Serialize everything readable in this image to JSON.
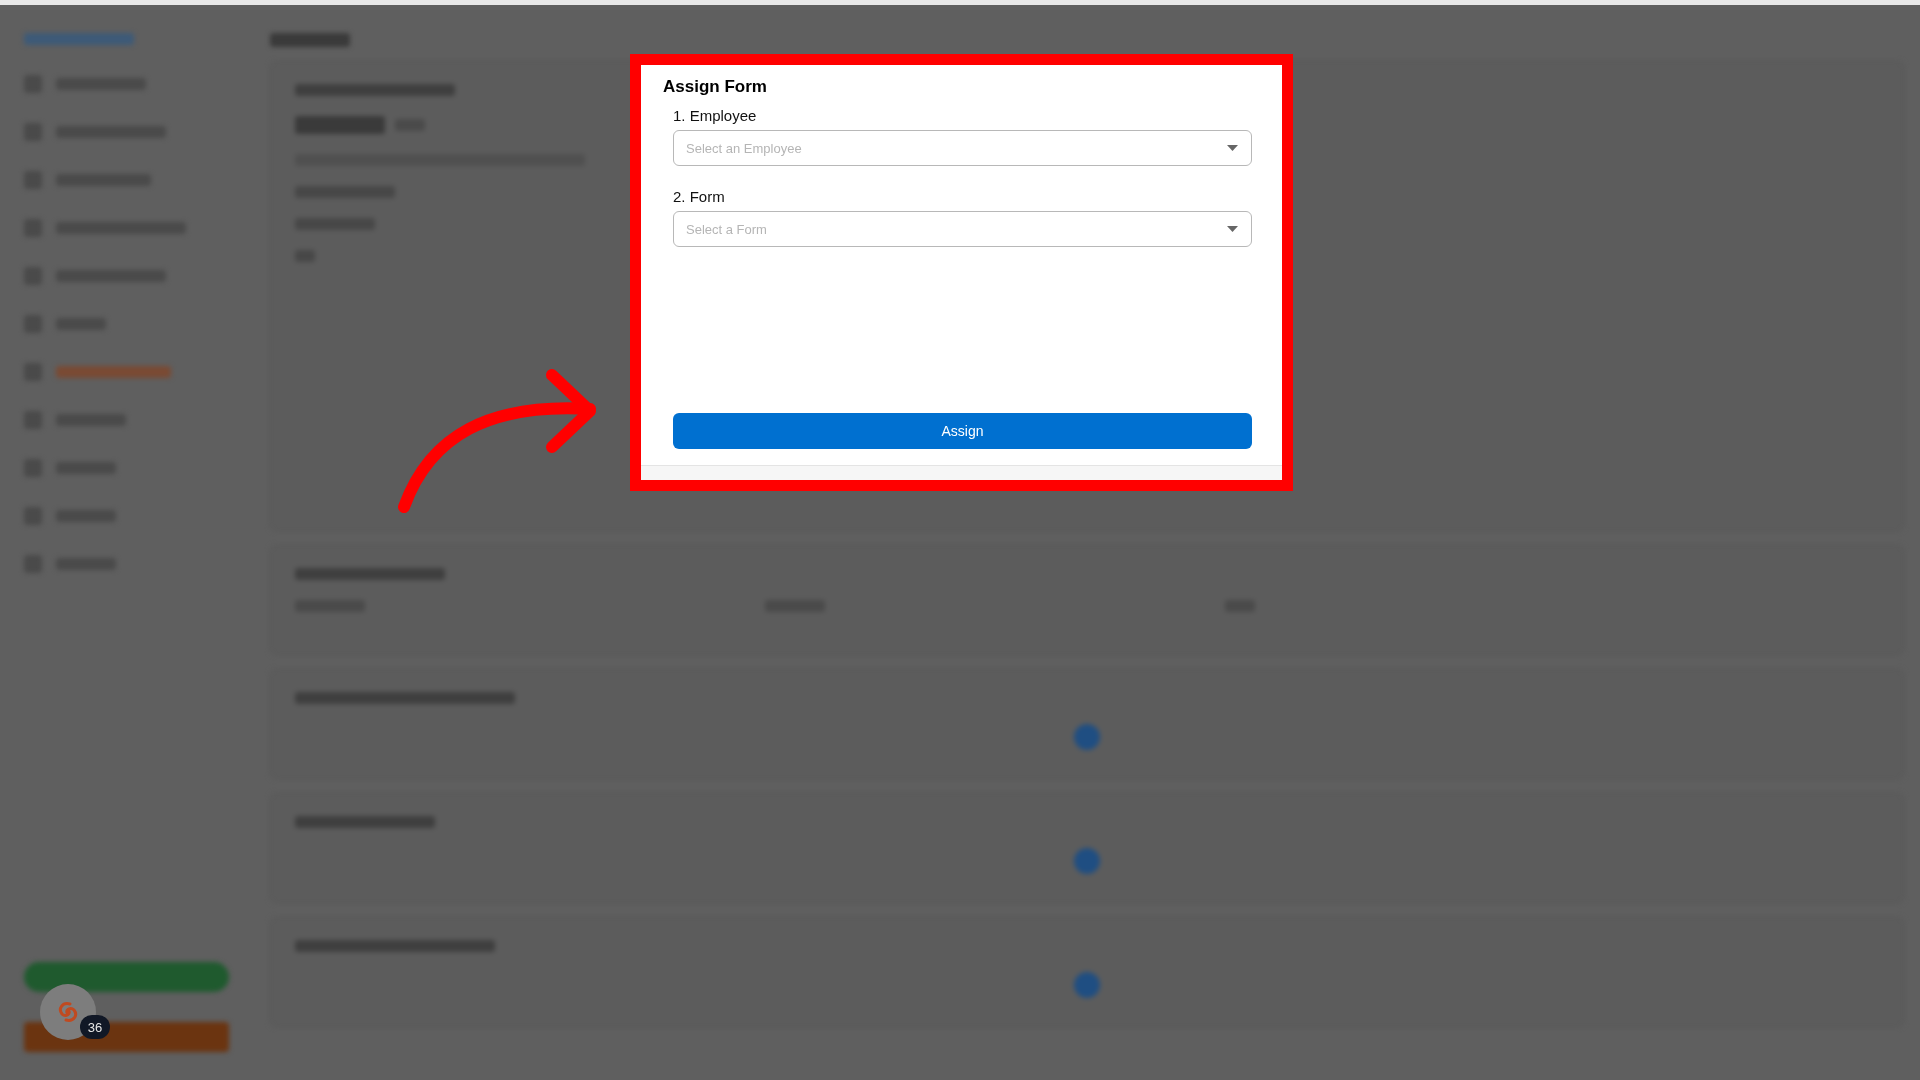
{
  "dialog": {
    "title": "Assign Form",
    "fields": [
      {
        "label": "1. Employee",
        "placeholder": "Select an Employee"
      },
      {
        "label": "2. Form",
        "placeholder": "Select a Form"
      }
    ],
    "button": "Assign"
  },
  "chat_widget": {
    "badge": "36"
  }
}
